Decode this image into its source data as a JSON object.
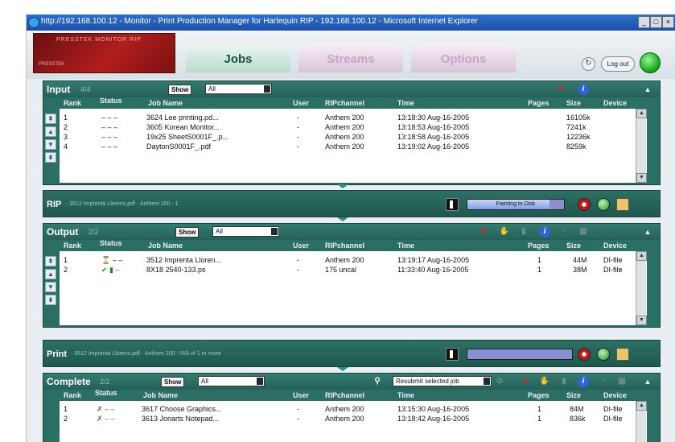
{
  "window": {
    "title": "http://192.168.100.12 - Monitor - Print Production Manager for Harlequin RIP - 192.168.100.12 - Microsoft Internet Explorer",
    "min": "_",
    "max": "□",
    "close": "×"
  },
  "header": {
    "logo_text": "PRESSTEK MONITOR RIP",
    "logo_sub": "PRESSTEK",
    "tabs": [
      "Jobs",
      "Streams",
      "Options"
    ],
    "logout": "Log out",
    "refresh": "↻"
  },
  "input": {
    "title": "Input",
    "count": "4/4",
    "show_label": "Show",
    "filter": "All",
    "columns": [
      "Rank",
      "Status",
      "Job Name",
      "User",
      "RIPchannel",
      "Time",
      "Pages",
      "Size",
      "Device"
    ],
    "rows": [
      {
        "rank": "1",
        "status": "– – –",
        "job": "3624 Lee printing.pd...",
        "user": "-",
        "channel": "Anthem 200",
        "time": "13:18:30 Aug-16-2005",
        "pages": "",
        "size": "16105k",
        "device": ""
      },
      {
        "rank": "2",
        "status": "– – –",
        "job": "3605 Korean Monitor...",
        "user": "-",
        "channel": "Anthem 200",
        "time": "13:18:53 Aug-16-2005",
        "pages": "",
        "size": "7241k",
        "device": ""
      },
      {
        "rank": "3",
        "status": "– – –",
        "job": "19x25 SheetS0001F_.p...",
        "user": "-",
        "channel": "Anthem 200",
        "time": "13:18:58 Aug-16-2005",
        "pages": "",
        "size": "12236k",
        "device": ""
      },
      {
        "rank": "4",
        "status": "– – –",
        "job": "DaytonS0001F_.pdf",
        "user": "-",
        "channel": "Anthem 200",
        "time": "13:19:02 Aug-16-2005",
        "pages": "",
        "size": "8259k",
        "device": ""
      }
    ]
  },
  "rip": {
    "label": "RIP",
    "detail": "-  3512 Imprenta Llorens.pdf  -  Anthem 200  -  1",
    "progress_text": "Painting to Disk",
    "progress": 0.85
  },
  "output": {
    "title": "Output",
    "count": "2/2",
    "show_label": "Show",
    "filter": "All",
    "columns": [
      "Rank",
      "Status",
      "Job Name",
      "User",
      "RIPchannel",
      "Time",
      "Pages",
      "Size",
      "Device"
    ],
    "rows": [
      {
        "rank": "1",
        "status": "⌛ – –",
        "job": "3512 Imprenta Lloren...",
        "user": "-",
        "channel": "Anthem 200",
        "time": "13:19:17 Aug-16-2005",
        "pages": "1",
        "size": "44M",
        "device": "DI-file"
      },
      {
        "rank": "2",
        "status": "✔ ▮ –",
        "job": "8X18 2540-133.ps",
        "user": "-",
        "channel": "175 uncal",
        "time": "11:33:40 Aug-16-2005",
        "pages": "1",
        "size": "38M",
        "device": "DI-file"
      }
    ]
  },
  "print": {
    "label": "Print",
    "detail": "-  3512 Imprenta Llorens.pdf  -  Anthem 200  -  N/A of 1 or more",
    "progress": 0
  },
  "complete": {
    "title": "Complete",
    "count": "2/2",
    "show_label": "Show",
    "filter": "All",
    "resubmit": "Resubmit selected job",
    "columns": [
      "Rank",
      "Status",
      "Job Name",
      "User",
      "RIPchannel",
      "Time",
      "Pages",
      "Size",
      "Device"
    ],
    "rows": [
      {
        "rank": "1",
        "status": "✗ – –",
        "job": "3617 Choose Graphics...",
        "user": "-",
        "channel": "Anthem 200",
        "time": "13:15:30 Aug-16-2005",
        "pages": "1",
        "size": "84M",
        "device": "DI-file"
      },
      {
        "rank": "2",
        "status": "✗ – –",
        "job": "3613 Jonarts Notepad...",
        "user": "-",
        "channel": "Anthem 200",
        "time": "13:18:42 Aug-16-2005",
        "pages": "1",
        "size": "836k",
        "device": "DI-file"
      }
    ]
  },
  "colors": {
    "panel": "#2b6e64",
    "accent_red": "#e0261c",
    "info_blue": "#2f64d6"
  }
}
